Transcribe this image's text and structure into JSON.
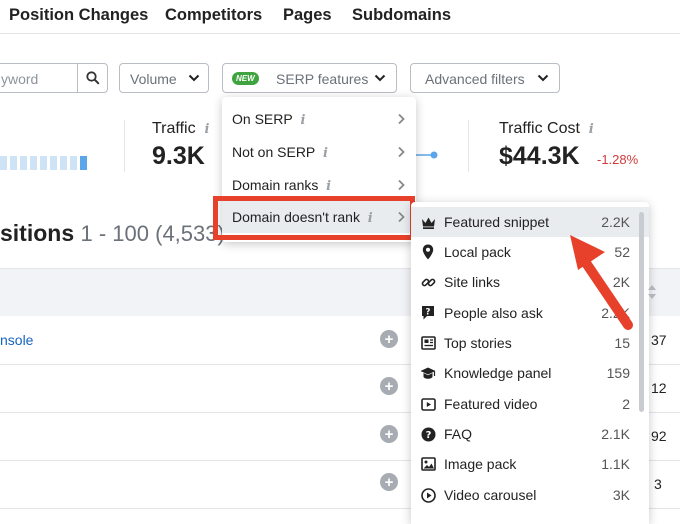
{
  "tabs": [
    "Position Changes",
    "Competitors",
    "Pages",
    "Subdomains"
  ],
  "search": {
    "placeholder": "yword"
  },
  "filters": {
    "volume_label": "Volume",
    "serp_badge": "NEW",
    "serp_label": "SERP features",
    "advanced_label": "Advanced filters"
  },
  "kpis": {
    "traffic": {
      "label": "Traffic",
      "value": "9.3K"
    },
    "traffic_cost": {
      "label": "Traffic Cost",
      "value": "$44.3K",
      "change": "-1.28%"
    },
    "info_glyph": "i"
  },
  "positions": {
    "title": "sitions",
    "range": "1 - 100 (4,533)"
  },
  "table": {
    "first_link": "nsole",
    "row_values": [
      "37",
      "12",
      "92",
      "3"
    ]
  },
  "serp_menu": {
    "items": [
      {
        "label": "On SERP",
        "has_info": true
      },
      {
        "label": "Not on SERP",
        "has_info": true
      },
      {
        "label": "Domain ranks",
        "has_info": true
      },
      {
        "label": "Domain doesn't rank",
        "has_info": true,
        "active": true
      }
    ]
  },
  "features_menu": {
    "items": [
      {
        "label": "Featured snippet",
        "count": "2.2K",
        "icon": "crown-icon",
        "active": true
      },
      {
        "label": "Local pack",
        "count": "52",
        "icon": "map-pin-icon"
      },
      {
        "label": "Site links",
        "count": "2K",
        "icon": "link-icon"
      },
      {
        "label": "People also ask",
        "count": "2.2K",
        "icon": "question-bubble-icon"
      },
      {
        "label": "Top stories",
        "count": "15",
        "icon": "newspaper-icon"
      },
      {
        "label": "Knowledge panel",
        "count": "159",
        "icon": "graduation-cap-icon"
      },
      {
        "label": "Featured video",
        "count": "2",
        "icon": "video-play-icon"
      },
      {
        "label": "FAQ",
        "count": "2.1K",
        "icon": "faq-icon"
      },
      {
        "label": "Image pack",
        "count": "1.1K",
        "icon": "image-icon"
      },
      {
        "label": "Video carousel",
        "count": "3K",
        "icon": "video-carousel-icon"
      }
    ]
  },
  "colors": {
    "accent_red": "#e8412b",
    "link": "#1565c0",
    "negative": "#d23b3b",
    "new_badge": "#3fa33f"
  }
}
